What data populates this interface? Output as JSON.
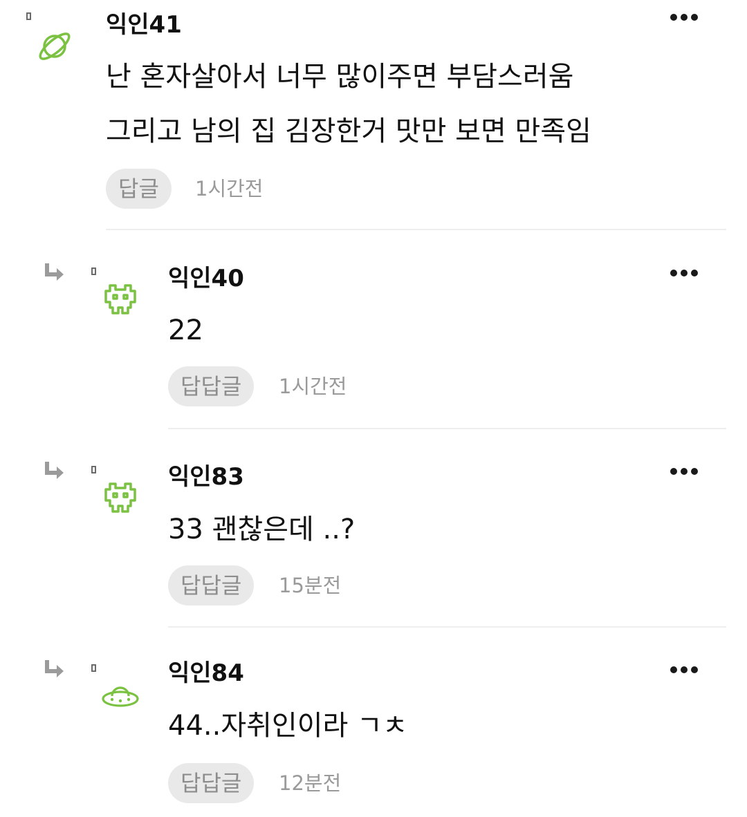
{
  "comments": [
    {
      "author": "익인41",
      "avatar_icon": "planet-icon",
      "lines": [
        "난 혼자살아서 너무 많이주면 부담스러움",
        "그리고 남의 집 김장한거 맛만 보면 만족임"
      ],
      "reply_label": "답글",
      "time": "1시간전"
    },
    {
      "author": "익인40",
      "avatar_icon": "space-invader-icon",
      "lines": [
        "22"
      ],
      "reply_label": "답답글",
      "time": "1시간전"
    },
    {
      "author": "익인83",
      "avatar_icon": "space-invader-icon",
      "lines": [
        "33 괜찮은데 ..?"
      ],
      "reply_label": "답답글",
      "time": "15분전"
    },
    {
      "author": "익인84",
      "avatar_icon": "ufo-icon",
      "lines": [
        "44..자취인이라 ㄱㅊ"
      ],
      "reply_label": "답답글",
      "time": "12분전"
    }
  ],
  "colors": {
    "avatar_green": "#7cc242",
    "reply_arrow": "#9b9b9b",
    "reply_button_bg": "#e9e9e9",
    "muted_text": "#9a9a9a"
  }
}
